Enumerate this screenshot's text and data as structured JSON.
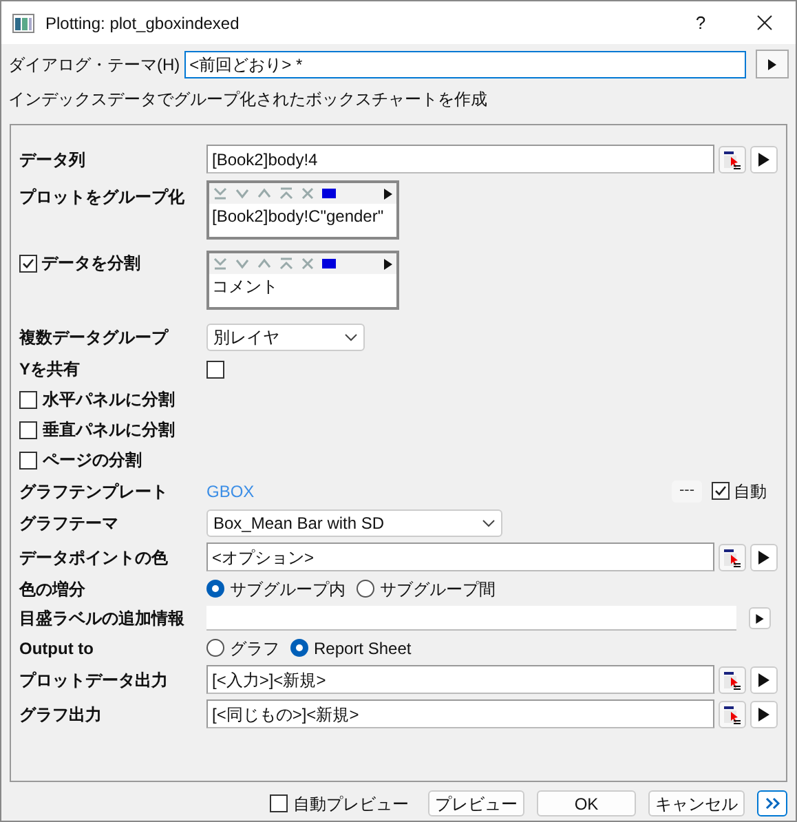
{
  "window": {
    "title": "Plotting: plot_gboxindexed",
    "help": "?"
  },
  "theme": {
    "label": "ダイアログ・テーマ(H)",
    "value": "<前回どおり> *"
  },
  "description": "インデックスデータでグループ化されたボックスチャートを作成",
  "rows": [
    {
      "kind": "input",
      "label": "データ列",
      "value": "[Book2]body!4"
    },
    {
      "kind": "list",
      "label": "プロットをグループ化",
      "value": "[Book2]body!C\"gender\""
    },
    {
      "kind": "check_list",
      "label": "データを分割",
      "checked": true,
      "value": "コメント"
    },
    {
      "kind": "select_short",
      "label": "複数データグループ",
      "value": "別レイヤ"
    },
    {
      "kind": "checkbox",
      "label": "Yを共有",
      "checked": false
    },
    {
      "kind": "check_label",
      "label": "水平パネルに分割",
      "checked": false
    },
    {
      "kind": "check_label",
      "label": "垂直パネルに分割",
      "checked": false
    },
    {
      "kind": "check_label",
      "label": "ページの分割",
      "checked": false
    },
    {
      "kind": "template",
      "label": "グラフテンプレート",
      "value": "GBOX",
      "button": "---",
      "auto_label": "自動",
      "auto_checked": true
    },
    {
      "kind": "select",
      "label": "グラフテーマ",
      "value": "Box_Mean Bar with SD"
    },
    {
      "kind": "input",
      "label": "データポイントの色",
      "value": "<オプション>"
    },
    {
      "kind": "radio",
      "label": "色の増分",
      "options": [
        {
          "label": "サブグループ内",
          "selected": true
        },
        {
          "label": "サブグループ間",
          "selected": false
        }
      ]
    },
    {
      "kind": "blank_input",
      "label": "目盛ラベルの追加情報"
    },
    {
      "kind": "radio",
      "label": "Output to",
      "options": [
        {
          "label": "グラフ",
          "selected": false
        },
        {
          "label": "Report Sheet",
          "selected": true
        }
      ]
    },
    {
      "kind": "input",
      "label": "プロットデータ出力",
      "value": "[<入力>]<新規>"
    },
    {
      "kind": "input",
      "label": "グラフ出力",
      "value": "[<同じもの>]<新規>"
    }
  ],
  "footer": {
    "auto_preview": {
      "label": "自動プレビュー",
      "checked": false
    },
    "buttons": [
      "プレビュー",
      "OK",
      "キャンセル"
    ]
  }
}
